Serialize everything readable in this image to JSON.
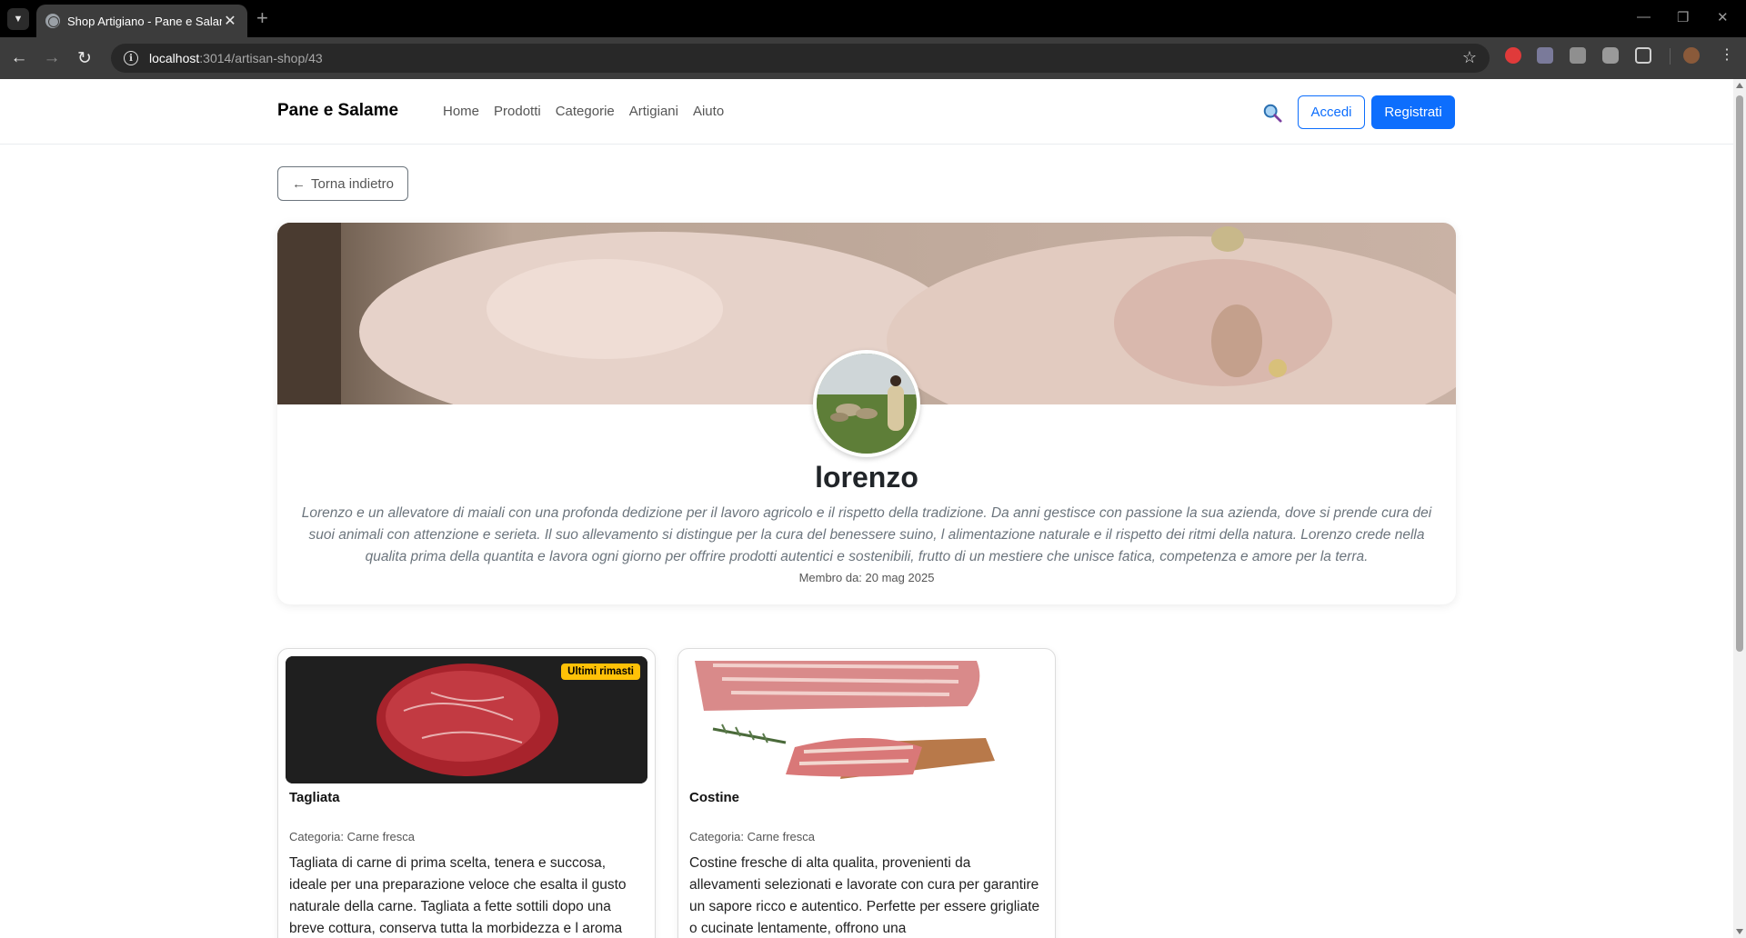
{
  "browser": {
    "tab_title": "Shop Artigiano - Pane e Salame",
    "url_host": "localhost",
    "url_path": ":3014/artisan-shop/43"
  },
  "header": {
    "brand": "Pane e Salame",
    "nav": [
      "Home",
      "Prodotti",
      "Categorie",
      "Artigiani",
      "Aiuto"
    ],
    "login_label": "Accedi",
    "register_label": "Registrati"
  },
  "back_label": "Torna indietro",
  "artisan": {
    "name": "lorenzo",
    "bio": "Lorenzo e un allevatore di maiali con una profonda dedizione per il lavoro agricolo e il rispetto della tradizione. Da anni gestisce con passione la sua azienda, dove si prende cura dei suoi animali con attenzione e serieta. Il suo allevamento si distingue per la cura del benessere suino, l alimentazione naturale e il rispetto dei ritmi della natura. Lorenzo crede nella qualita prima della quantita e lavora ogni giorno per offrire prodotti autentici e sostenibili, frutto di un mestiere che unisce fatica, competenza e amore per la terra.",
    "member_since": "Membro da: 20 mag 2025"
  },
  "products": [
    {
      "name": "Tagliata",
      "badge": "Ultimi rimasti",
      "category": "Categoria: Carne fresca",
      "description": "Tagliata di carne di prima scelta, tenera e succosa, ideale per una preparazione veloce che esalta il gusto naturale della carne. Tagliata a fette sottili dopo una breve cottura, conserva tutta la morbidezza e l aroma"
    },
    {
      "name": "Costine",
      "category": "Categoria: Carne fresca",
      "description": "Costine fresche di alta qualita, provenienti da allevamenti selezionati e lavorate con cura per garantire un sapore ricco e autentico. Perfette per essere grigliate o cucinate lentamente, offrono una"
    }
  ],
  "colors": {
    "primary": "#0d6efd",
    "badge": "#ffc107",
    "chrome_dark": "#3c3c3c"
  }
}
